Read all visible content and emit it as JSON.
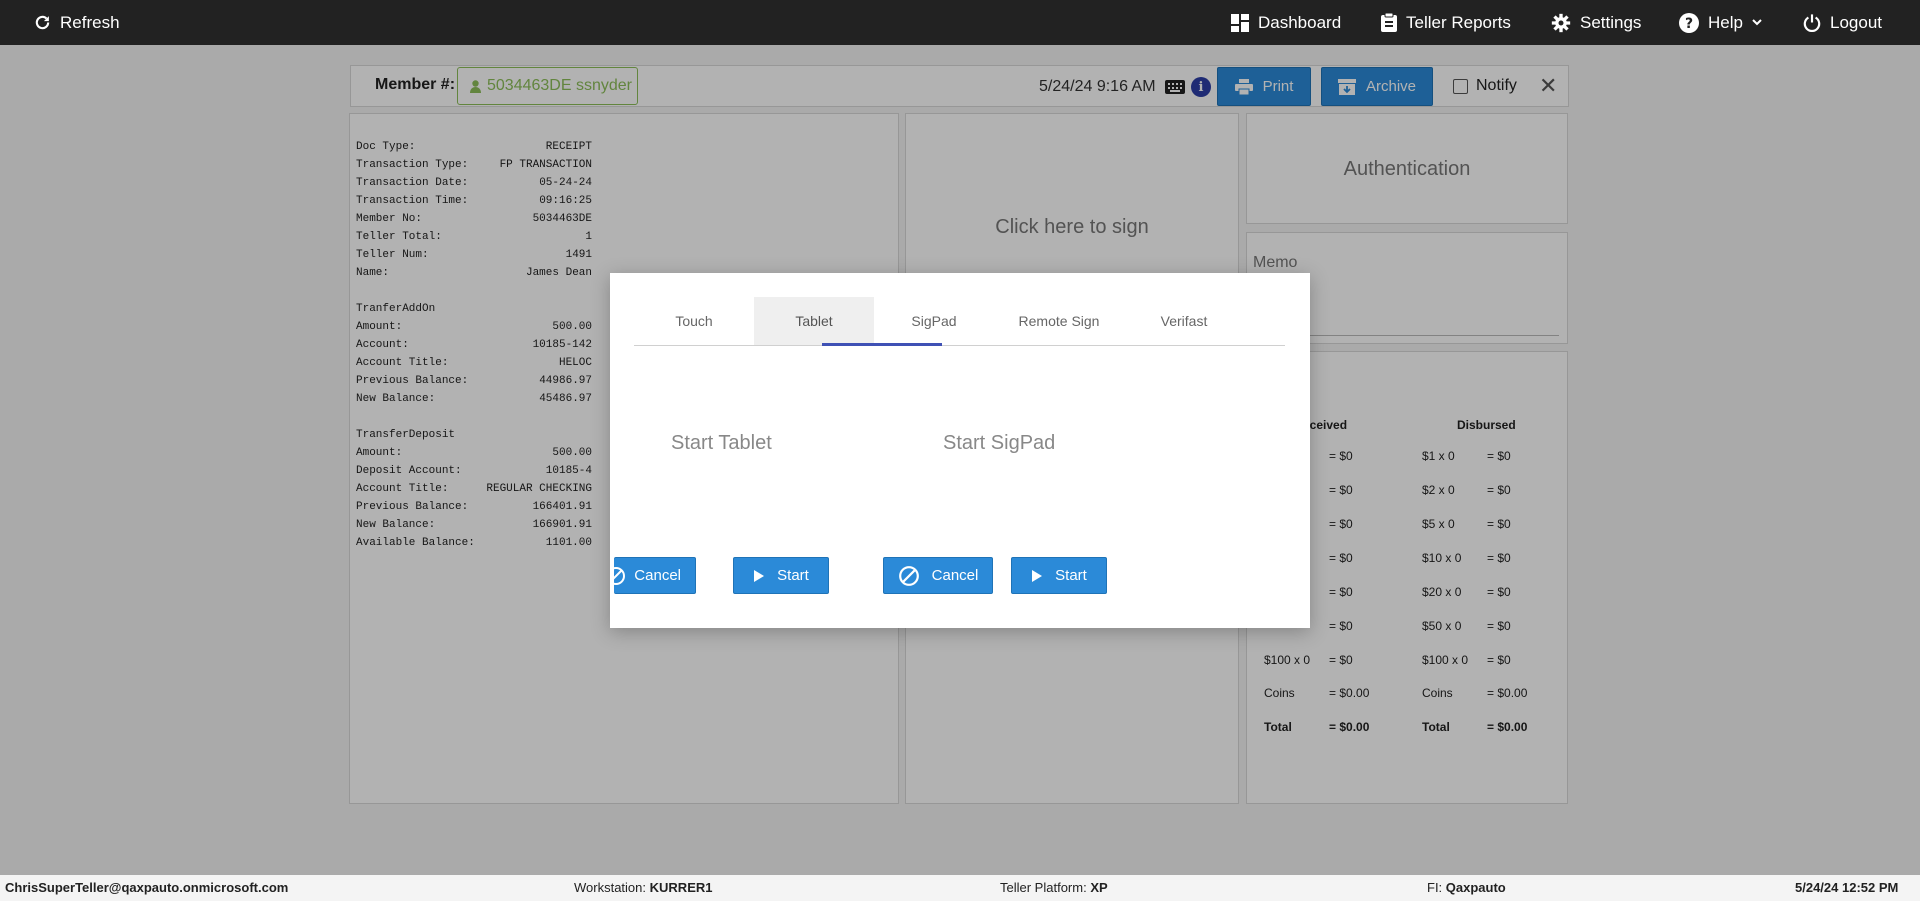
{
  "topbar": {
    "refresh_label": "Refresh",
    "dashboard_label": "Dashboard",
    "teller_reports_label": "Teller Reports",
    "settings_label": "Settings",
    "help_label": "Help",
    "logout_label": "Logout"
  },
  "member": {
    "label": "Member #:",
    "value": "5034463DE ssnyder",
    "datetime": "5/24/24 9:16 AM",
    "info": "i",
    "print_label": "Print",
    "archive_label": "Archive",
    "notify_label": "Notify",
    "close": "✕"
  },
  "receipt": {
    "lines": [
      {
        "label": "Doc Type:",
        "value": "RECEIPT"
      },
      {
        "label": "Transaction Type:",
        "value": "FP TRANSACTION"
      },
      {
        "label": "Transaction Date:",
        "value": "05-24-24"
      },
      {
        "label": "Transaction Time:",
        "value": "09:16:25"
      },
      {
        "label": "Member No:",
        "value": "5034463DE"
      },
      {
        "label": "Teller Total:",
        "value": "1"
      },
      {
        "label": "Teller Num:",
        "value": "1491"
      },
      {
        "label": "Name:",
        "value": "James Dean"
      },
      {
        "label": "",
        "value": ""
      },
      {
        "label": "TranferAddOn",
        "value": ""
      },
      {
        "label": "Amount:",
        "value": "500.00"
      },
      {
        "label": "Account:",
        "value": "10185-142"
      },
      {
        "label": "Account Title:",
        "value": "HELOC"
      },
      {
        "label": "Previous Balance:",
        "value": "44986.97"
      },
      {
        "label": "New Balance:",
        "value": "45486.97"
      },
      {
        "label": "",
        "value": ""
      },
      {
        "label": "TransferDeposit",
        "value": ""
      },
      {
        "label": "Amount:",
        "value": "500.00"
      },
      {
        "label": "Deposit Account:",
        "value": "10185-4"
      },
      {
        "label": "Account Title:",
        "value": "REGULAR CHECKING"
      },
      {
        "label": "Previous Balance:",
        "value": "166401.91"
      },
      {
        "label": "New Balance:",
        "value": "166901.91"
      },
      {
        "label": "Available Balance:",
        "value": "1101.00"
      }
    ]
  },
  "sign": {
    "click_to_sign": "Click here to sign"
  },
  "auth": {
    "label": "Authentication"
  },
  "memo": {
    "label": "Memo"
  },
  "cash": {
    "received_header": "eceived",
    "disbursed_header": "Disbursed",
    "received_rows": [
      {
        "denom": "",
        "amount": "= $0"
      },
      {
        "denom": "",
        "amount": "= $0"
      },
      {
        "denom": "",
        "amount": "= $0"
      },
      {
        "denom": "",
        "amount": "= $0"
      },
      {
        "denom": "",
        "amount": "= $0"
      },
      {
        "denom": "",
        "amount": "= $0"
      },
      {
        "denom": "$100 x 0",
        "amount": "= $0"
      }
    ],
    "disbursed_rows": [
      {
        "denom": "$1 x 0",
        "amount": "= $0"
      },
      {
        "denom": "$2 x 0",
        "amount": "= $0"
      },
      {
        "denom": "$5 x 0",
        "amount": "= $0"
      },
      {
        "denom": "$10 x 0",
        "amount": "= $0"
      },
      {
        "denom": "$20 x 0",
        "amount": "= $0"
      },
      {
        "denom": "$50 x 0",
        "amount": "= $0"
      },
      {
        "denom": "$100 x 0",
        "amount": "= $0"
      }
    ],
    "coins_label": "Coins",
    "coins_received": "= $0.00",
    "coins_disbursed": "= $0.00",
    "total_label": "Total",
    "total_received": "= $0.00",
    "total_disbursed": "= $0.00"
  },
  "modal": {
    "tabs": [
      "Touch",
      "Tablet",
      "SigPad",
      "Remote Sign",
      "Verifast"
    ],
    "active_tab": "Tablet",
    "tablet_heading": "Start Tablet",
    "sigpad_heading": "Start SigPad",
    "cancel_label": "Cancel",
    "start_label": "Start"
  },
  "footer": {
    "user": "ChrisSuperTeller@qaxpauto.onmicrosoft.com",
    "workstation_label": "Workstation:",
    "workstation_value": "KURRER1",
    "platform_label": "Teller Platform:",
    "platform_value": "XP",
    "fi_label": "FI:",
    "fi_value": "Qaxpauto",
    "datetime": "5/24/24 12:52 PM"
  },
  "colors": {
    "topbar": "#222222",
    "primary_button": "#2b8ad8",
    "member_chip": "#8dbf5a",
    "tab_indicator": "#3f51b5",
    "info_badge": "#2d3ea6"
  }
}
